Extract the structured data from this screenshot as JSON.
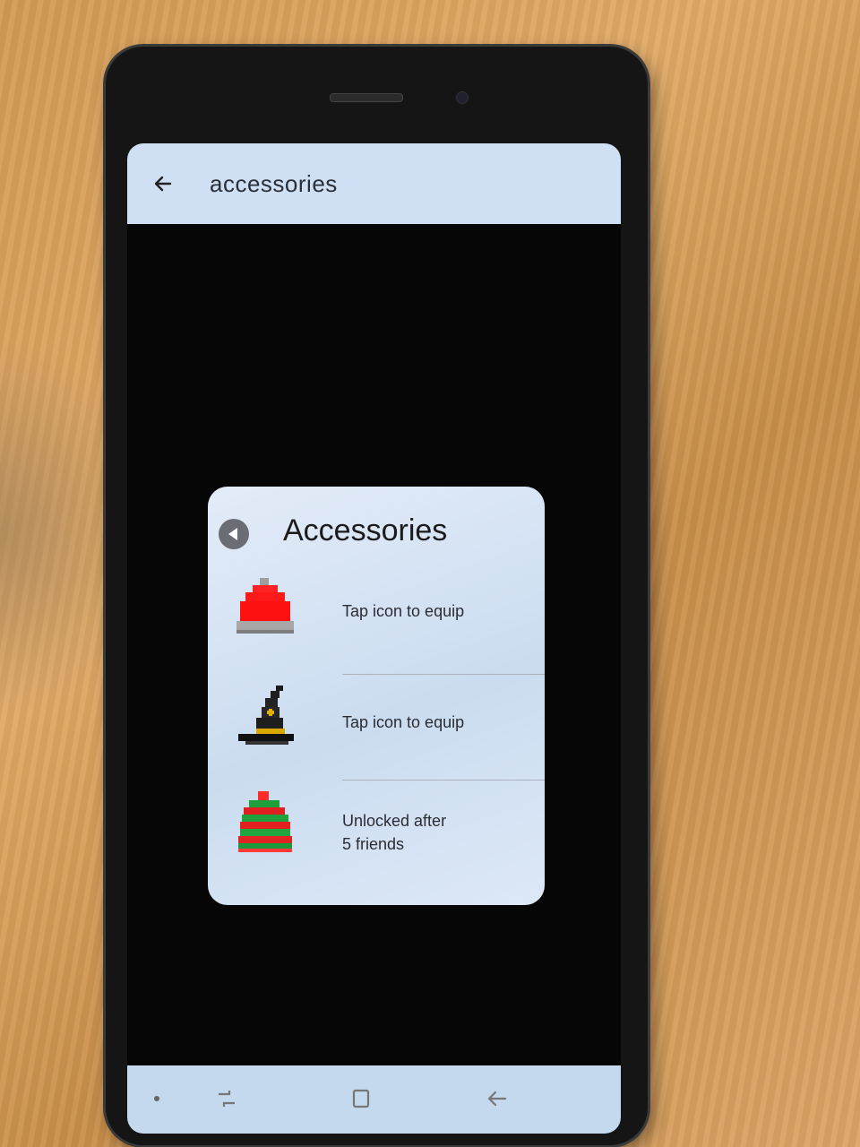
{
  "app_bar": {
    "back_icon": "arrow-left-icon",
    "title": "accessories"
  },
  "dialog": {
    "back_icon": "back-circle-icon",
    "title": "Accessories",
    "items": [
      {
        "icon": "red-beanie-icon",
        "line1": "Tap icon to equip",
        "line2": ""
      },
      {
        "icon": "witch-hat-icon",
        "line1": "Tap icon to equip",
        "line2": ""
      },
      {
        "icon": "striped-beanie-icon",
        "line1": "Unlocked after",
        "line2": "5 friends"
      }
    ]
  },
  "nav_bar": {
    "icons": [
      "recent-apps-icon",
      "home-icon",
      "back-icon"
    ]
  },
  "colors": {
    "app_bar": "#cfe0f4",
    "dialog": "#dce8f6",
    "nav_bar": "#c4d8ee"
  }
}
